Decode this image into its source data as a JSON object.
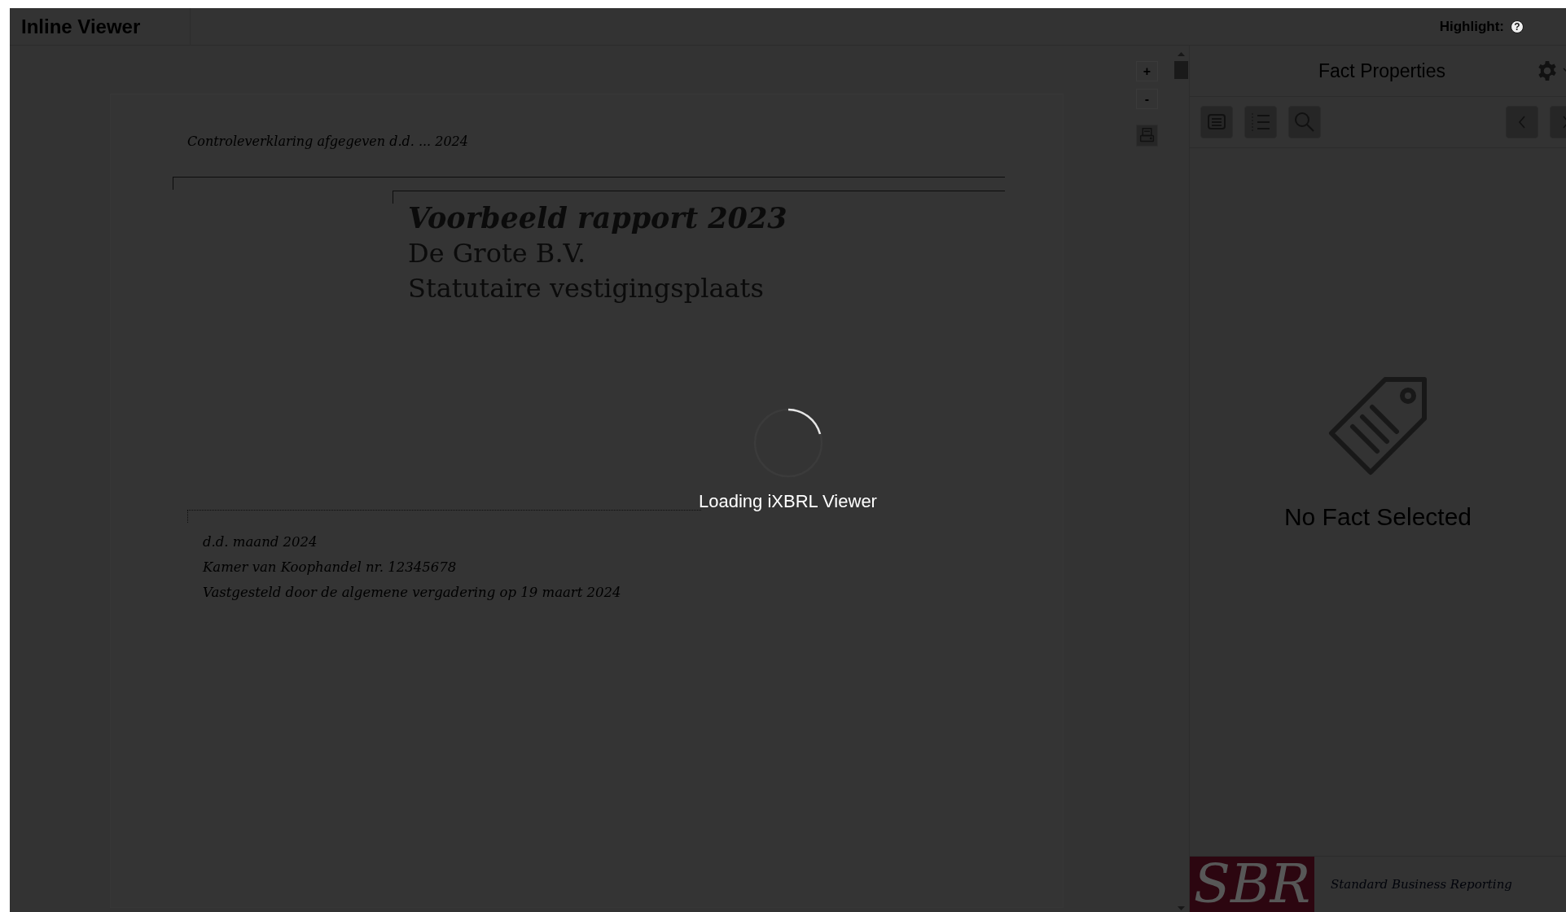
{
  "header": {
    "title": "Inline Viewer",
    "highlight_label": "Highlight:",
    "help_text": "?"
  },
  "viewer": {
    "zoom_in": "+",
    "zoom_out": "-",
    "document": {
      "audit_note": "Controleverklaring afgegeven d.d. ... 2024",
      "report_title": "Voorbeeld rapport 2023",
      "company": "De Grote B.V.",
      "seat": "Statutaire vestigingsplaats",
      "details": [
        "d.d. maand 2024",
        "Kamer van Koophandel nr. 12345678",
        "Vastgesteld door de algemene vergadering op 19 maart 2024"
      ]
    }
  },
  "loading": {
    "text": "Loading iXBRL Viewer"
  },
  "fact_panel": {
    "title": "Fact Properties",
    "empty_text": "No Fact Selected"
  },
  "footer": {
    "logo": "SBR",
    "tagline": "Standard Business Reporting"
  }
}
